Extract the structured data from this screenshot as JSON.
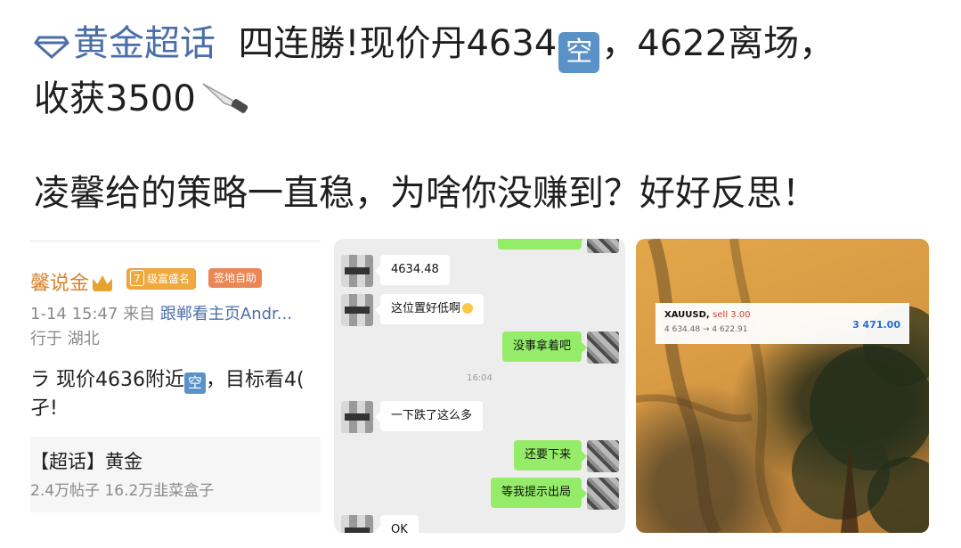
{
  "post": {
    "topic": "黄金超话",
    "line1_text": "四连勝!现价丹4634",
    "kuang_glyph": "空",
    "line1_tail": "，4622离场，",
    "line2_text": "收获3500",
    "line3_text": "凌馨给的策略一直稳，为啥你没赚到？好好反思！"
  },
  "weibo_card": {
    "author": "馨说金",
    "level": "7",
    "level_badge": "级富盛名",
    "sign_badge": "签地自助",
    "meta_time": "1-14 15:47  来自",
    "meta_link": "跟郸看主页Andr...",
    "meta_location": "行于 湖北",
    "body_line1_a": "ラ 现价4636附近",
    "body_line1_kuang": "空",
    "body_line1_b": "，目标看4(",
    "body_line2": "孑!",
    "topic_title": "【超话】黄金",
    "topic_stats": "2.4万帖子 16.2万韭菜盒子"
  },
  "chat": {
    "messages": [
      {
        "side": "l",
        "text": "4634.48"
      },
      {
        "side": "l",
        "text": "这位置好低啊"
      },
      {
        "side": "r",
        "text": "没事拿着吧"
      },
      {
        "side": "time",
        "text": "16:04"
      },
      {
        "side": "l",
        "text": "一下跌了这么多"
      },
      {
        "side": "r",
        "text": "还要下来"
      },
      {
        "side": "r",
        "text": "等我提示出局"
      },
      {
        "side": "l",
        "text": "OK"
      }
    ]
  },
  "trade": {
    "symbol": "XAUUSD,",
    "action": "sell 3.00",
    "price_move": "4 634.48 → 4 622.91",
    "profit": "3 471.00",
    "profit_color": "#1f6fd6"
  },
  "colors": {
    "topic_blue": "#4a6fa8",
    "kuang_bg": "#5a92c8",
    "wechat_bg": "#ededed",
    "wechat_green": "#95ec69",
    "author_orange": "#d9822b"
  }
}
